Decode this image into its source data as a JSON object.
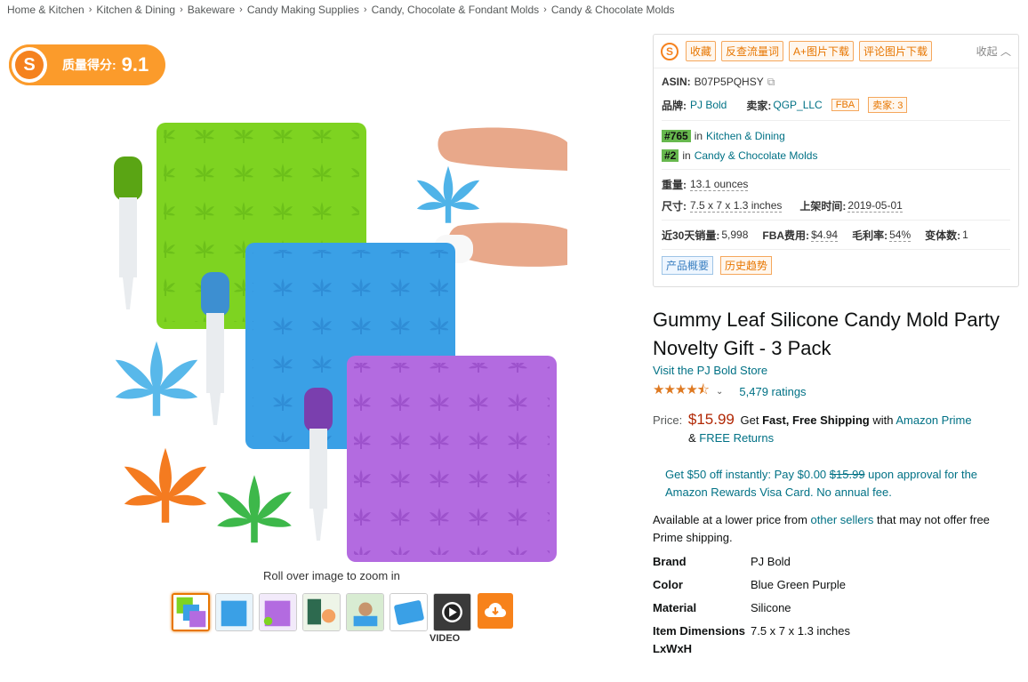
{
  "breadcrumb": [
    "Home & Kitchen",
    "Kitchen & Dining",
    "Bakeware",
    "Candy Making Supplies",
    "Candy, Chocolate & Fondant Molds",
    "Candy & Chocolate Molds"
  ],
  "score_badge": {
    "logo": "S",
    "label": "质量得分:",
    "value": "9.1"
  },
  "image": {
    "zoom_hint": "Roll over image to zoom in",
    "video_label": "VIDEO",
    "thumbnail_count": 8
  },
  "plugin": {
    "logo": "S",
    "buttons": [
      "收藏",
      "反查流量词",
      "A+图片下载",
      "评论图片下载"
    ],
    "collapse": "收起",
    "asin_label": "ASIN:",
    "asin": "B07P5PQHSY",
    "brand_label": "品牌:",
    "brand": "PJ Bold",
    "seller_label": "卖家:",
    "seller": "QGP_LLC",
    "fba_tag": "FBA",
    "sellers_count": "卖家: 3",
    "rank1_badge": "#765",
    "rank1_in": "in",
    "rank1_cat": "Kitchen & Dining",
    "rank2_badge": "#2",
    "rank2_in": "in",
    "rank2_cat": "Candy & Chocolate Molds",
    "weight_label": "重量:",
    "weight": "13.1 ounces",
    "size_label": "尺寸:",
    "size": "7.5 x 7 x 1.3 inches",
    "listed_label": "上架时间:",
    "listed": "2019-05-01",
    "sales_label": "近30天销量:",
    "sales": "5,998",
    "fba_fee_label": "FBA费用:",
    "fba_fee": "$4.94",
    "margin_label": "毛利率:",
    "margin": "54%",
    "variants_label": "变体数:",
    "variants": "1",
    "chip_overview": "产品概要",
    "chip_history": "历史趋势"
  },
  "product": {
    "title": "Gummy Leaf Silicone Candy Mold Party Novelty Gift - 3 Pack",
    "store": "Visit the PJ Bold Store",
    "stars": "★★★★⯪",
    "rating_value": 4.5,
    "ratings": "5,479 ratings",
    "price_label": "Price:",
    "price": "$15.99",
    "shipping_pre": "Get",
    "shipping_bold": "Fast, Free Shipping",
    "shipping_with": "with",
    "prime": "Amazon Prime",
    "amp": "&",
    "free_returns": "FREE Returns",
    "promo_pre": "Get $50 off instantly: Pay $0.00",
    "promo_strike": "$15.99",
    "promo_post": "upon approval for the Amazon Rewards Visa Card. No annual fee.",
    "lower_pre": "Available at a lower price from",
    "lower_link": "other sellers",
    "lower_post": "that may not offer free Prime shipping."
  },
  "specs": [
    {
      "key": "Brand",
      "value": "PJ Bold"
    },
    {
      "key": "Color",
      "value": "Blue Green Purple"
    },
    {
      "key": "Material",
      "value": "Silicone"
    },
    {
      "key": "Item Dimensions LxWxH",
      "value": "7.5 x 7 x 1.3 inches"
    }
  ],
  "colors": {
    "badge_orange": "#fb9b2b",
    "price_red": "#b12704",
    "link_teal": "#007185",
    "star_orange": "#de7921",
    "mold_green": "#7ed321",
    "mold_blue": "#3aa0e6",
    "mold_purple": "#b36be0"
  }
}
